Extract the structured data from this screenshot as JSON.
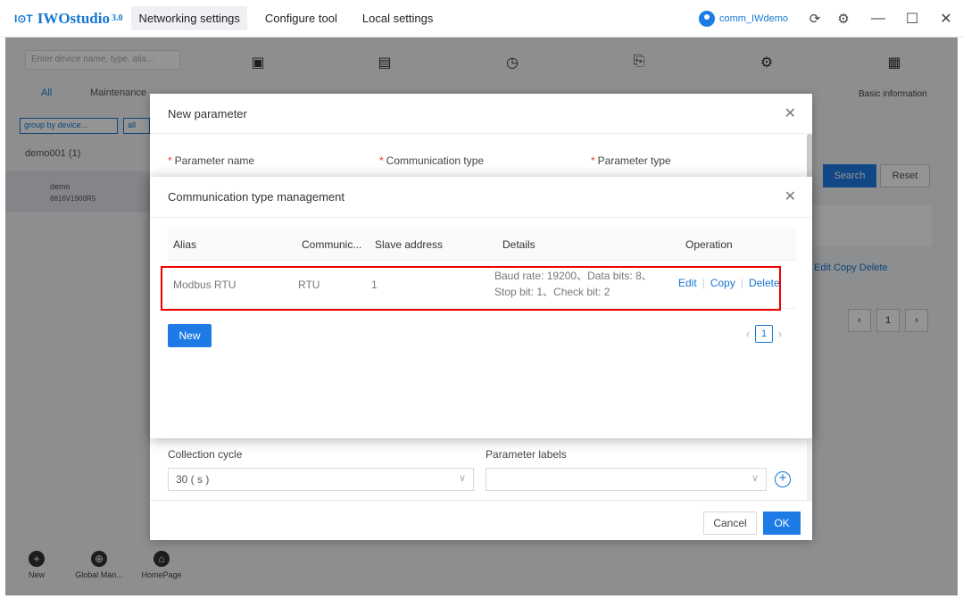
{
  "titlebar": {
    "logo_prefix": "I⊙T",
    "app_name": "IWOstudio",
    "version": "3.0",
    "nav": [
      "Networking settings",
      "Configure tool",
      "Local settings"
    ],
    "user": "comm_IWdemo"
  },
  "background": {
    "search_placeholder": "Enter device name, type, alia...",
    "tab_all": "All",
    "tab_maintenance": "Maintenance",
    "group_select": "group by device...",
    "all_select": "all",
    "tree_root": "demo001 (1)",
    "tree_child": "demo",
    "tree_child_id": "8816V1900R5",
    "basic_info": "Basic information",
    "search": "Search",
    "reset": "Reset",
    "ops": "Edit   Copy   Delete",
    "page": "1",
    "bottom": [
      "New",
      "Global Man...",
      "HomePage"
    ]
  },
  "new_param": {
    "title": "New parameter",
    "labels": {
      "parameter_name": "Parameter name",
      "communication_type": "Communication type",
      "parameter_type": "Parameter type",
      "collection_cycle": "Collection cycle",
      "parameter_labels": "Parameter labels"
    },
    "collection_cycle_value": "30 ( s )",
    "cancel": "Cancel",
    "ok": "OK"
  },
  "comm_mgmt": {
    "title": "Communication type management",
    "columns": [
      "Alias",
      "Communic...",
      "Slave address",
      "Details",
      "Operation"
    ],
    "rows": [
      {
        "alias": "Modbus RTU",
        "type": "RTU",
        "slave_address": "1",
        "details": "Baud rate: 19200、Data bits: 8、Stop bit: 1、Check bit: 2",
        "actions": [
          "Edit",
          "Copy",
          "Delete"
        ]
      }
    ],
    "new_button": "New",
    "page": "1"
  }
}
